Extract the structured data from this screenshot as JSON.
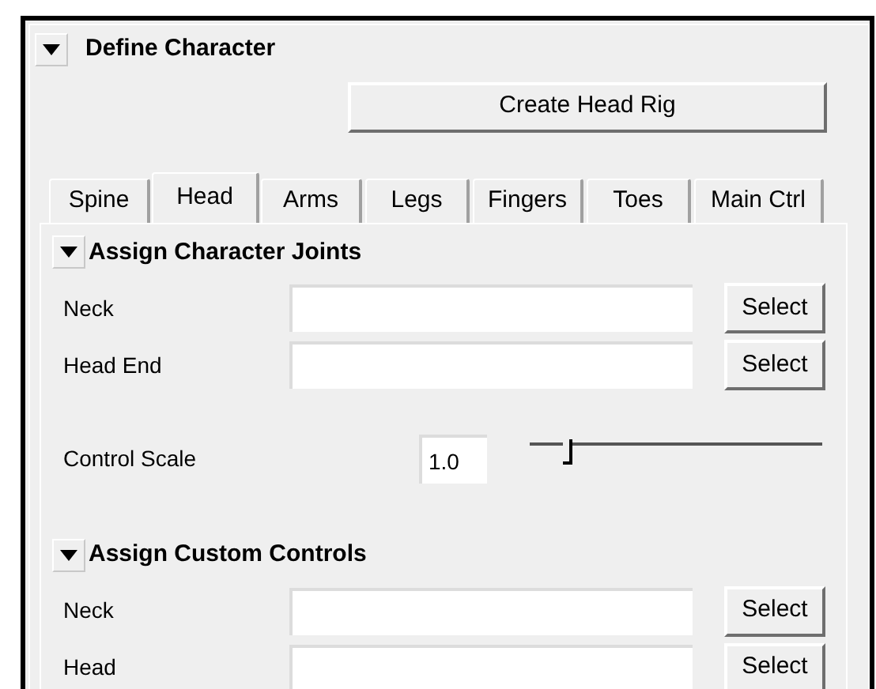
{
  "section": {
    "title": "Define Character",
    "expanded": true
  },
  "create_button": "Create Head Rig",
  "tabs": [
    {
      "label": "Spine",
      "selected": false
    },
    {
      "label": "Head",
      "selected": true
    },
    {
      "label": "Arms",
      "selected": false
    },
    {
      "label": "Legs",
      "selected": false
    },
    {
      "label": "Fingers",
      "selected": false
    },
    {
      "label": "Toes",
      "selected": false
    },
    {
      "label": "Main Ctrl",
      "selected": false
    }
  ],
  "groups": [
    {
      "title": "Assign Character Joints",
      "expanded": true,
      "rows": [
        {
          "kind": "field",
          "label": "Neck",
          "button": "Select"
        },
        {
          "kind": "field",
          "label": "Head End",
          "button": "Select"
        },
        {
          "kind": "slider",
          "label": "Control Scale",
          "value": "1.0",
          "level": 0.12
        }
      ]
    },
    {
      "title": "Assign Custom Controls",
      "expanded": true,
      "rows": [
        {
          "kind": "field",
          "label": "Neck",
          "button": "Select"
        },
        {
          "kind": "field",
          "label": "Head",
          "button": "Select"
        }
      ]
    }
  ]
}
